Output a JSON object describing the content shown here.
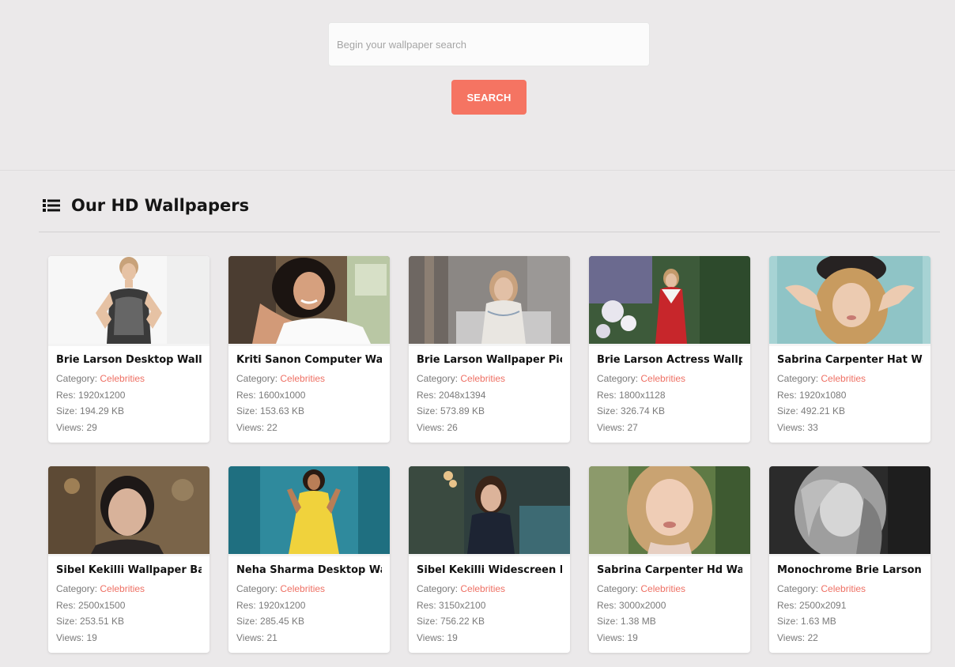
{
  "search": {
    "placeholder": "Begin your wallpaper search",
    "button_label": "SEARCH"
  },
  "section": {
    "title": "Our HD Wallpapers",
    "icon": "list-icon"
  },
  "labels": {
    "category": "Category: ",
    "res": "Res: ",
    "size": "Size: ",
    "views": "Views: "
  },
  "colors": {
    "accent": "#f57462",
    "category_link": "#ee6f63",
    "background": "#ebe9ea"
  },
  "wallpapers": [
    {
      "title": "Brie Larson Desktop Wallpaper",
      "category": "Celebrities",
      "res": "1920x1200",
      "size": "194.29 KB",
      "views": "29"
    },
    {
      "title": "Kriti Sanon Computer Wallpaper",
      "category": "Celebrities",
      "res": "1600x1000",
      "size": "153.63 KB",
      "views": "22"
    },
    {
      "title": "Brie Larson Wallpaper Picture",
      "category": "Celebrities",
      "res": "2048x1394",
      "size": "573.89 KB",
      "views": "26"
    },
    {
      "title": "Brie Larson Actress Wallpaper",
      "category": "Celebrities",
      "res": "1800x1128",
      "size": "326.74 KB",
      "views": "27"
    },
    {
      "title": "Sabrina Carpenter Hat Wallpaper",
      "category": "Celebrities",
      "res": "1920x1080",
      "size": "492.21 KB",
      "views": "33"
    },
    {
      "title": "Sibel Kekilli Wallpaper Background",
      "category": "Celebrities",
      "res": "2500x1500",
      "size": "253.51 KB",
      "views": "19"
    },
    {
      "title": "Neha Sharma Desktop Wallpaper",
      "category": "Celebrities",
      "res": "1920x1200",
      "size": "285.45 KB",
      "views": "21"
    },
    {
      "title": "Sibel Kekilli Widescreen Hd Wallpaper",
      "category": "Celebrities",
      "res": "3150x2100",
      "size": "756.22 KB",
      "views": "19"
    },
    {
      "title": "Sabrina Carpenter Hd Wallpaper",
      "category": "Celebrities",
      "res": "3000x2000",
      "size": "1.38 MB",
      "views": "19"
    },
    {
      "title": "Monochrome Brie Larson Wallpaper",
      "category": "Celebrities",
      "res": "2500x2091",
      "size": "1.63 MB",
      "views": "22"
    }
  ]
}
